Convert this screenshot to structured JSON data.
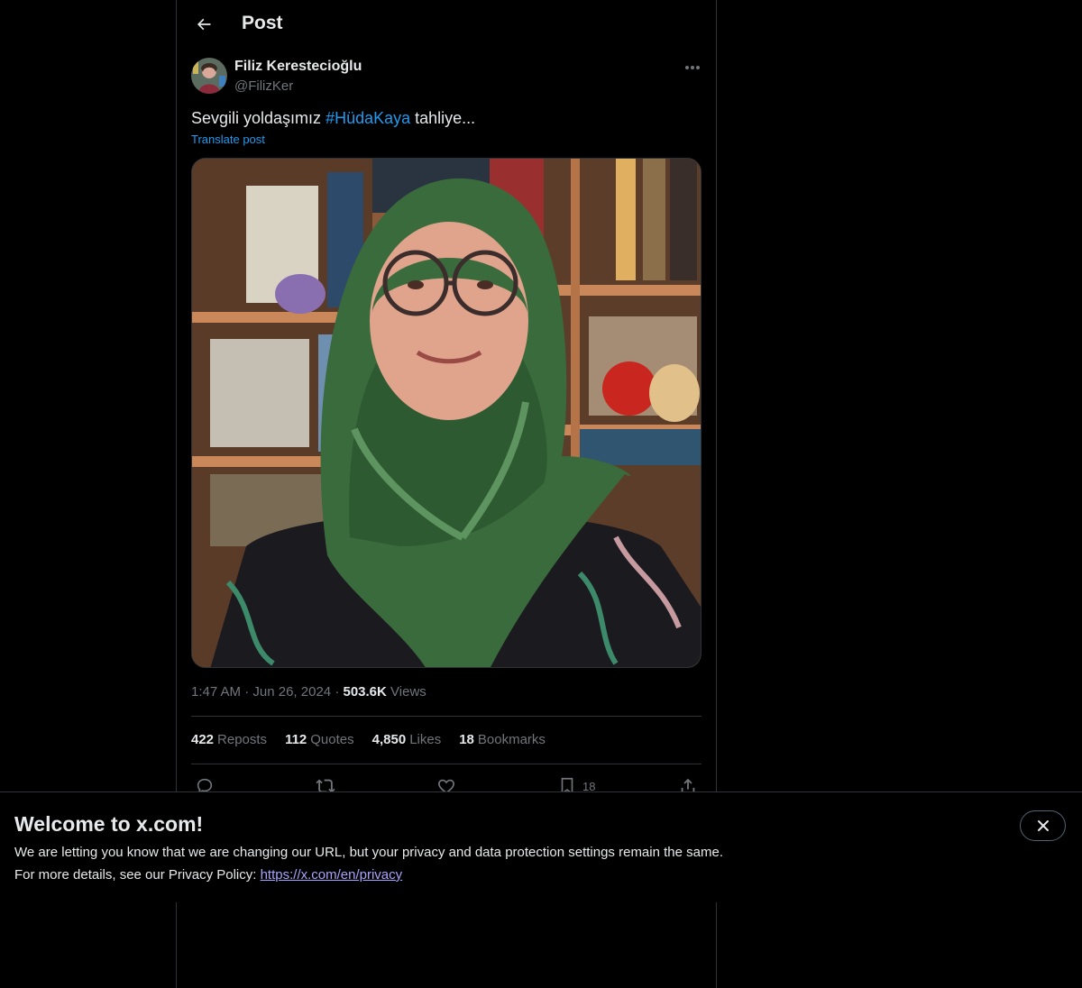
{
  "header": {
    "title": "Post",
    "back_icon": "arrow-left-icon"
  },
  "author": {
    "display_name": "Filiz Kerestecioğlu",
    "handle": "@FilizKer"
  },
  "post": {
    "text_before": "Sevgili yoldaşımız ",
    "hashtag": "#HüdaKaya",
    "text_after": " tahliye...",
    "translate_label": "Translate post",
    "time": "1:47 AM",
    "separator": "·",
    "date": "Jun 26, 2024",
    "views_count": "503.6K",
    "views_label": "Views"
  },
  "stats": {
    "reposts_count": "422",
    "reposts_label": "Reposts",
    "quotes_count": "112",
    "quotes_label": "Quotes",
    "likes_count": "4,850",
    "likes_label": "Likes",
    "bookmarks_count": "18",
    "bookmarks_label": "Bookmarks"
  },
  "actions": {
    "bookmark_count": "18"
  },
  "banner": {
    "title": "Welcome to x.com!",
    "line1": "We are letting you know that we are changing our URL, but your privacy and data protection settings remain the same.",
    "line2_prefix": "For more details, see our Privacy Policy: ",
    "link": "https://x.com/en/privacy"
  },
  "colors": {
    "background": "#000000",
    "text_primary": "#e7e9ea",
    "text_secondary": "#71767b",
    "accent": "#1d9bf0",
    "border": "#2f3336",
    "link_banner": "#a9a3ff"
  }
}
